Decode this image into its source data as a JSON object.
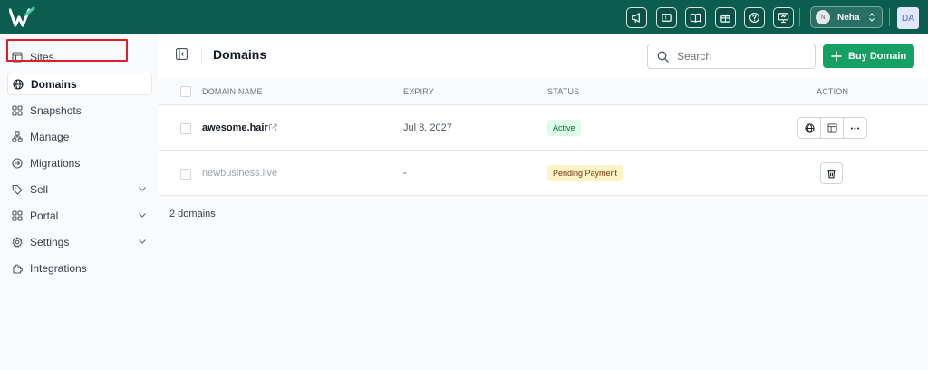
{
  "colors": {
    "topbar": "#0b5d4f",
    "brand_green": "#16a065",
    "highlight_border": "#e11d2a",
    "badge_active_bg": "#dcfce7",
    "badge_pending_bg": "#fef3c7"
  },
  "topbar": {
    "logo": "w-logo-icon",
    "icons": [
      "megaphone-icon",
      "ticket-icon",
      "book-icon",
      "gift-icon",
      "help-icon",
      "presentation-icon"
    ],
    "user": {
      "initial": "N",
      "name": "Neha"
    },
    "account_initials": "DA"
  },
  "sidebar": {
    "items": [
      {
        "label": "Sites",
        "icon": "layout-icon"
      },
      {
        "label": "Domains",
        "icon": "globe-icon",
        "active": true
      },
      {
        "label": "Snapshots",
        "icon": "grid-icon"
      },
      {
        "label": "Manage",
        "icon": "nodes-icon"
      },
      {
        "label": "Migrations",
        "icon": "arrow-circle-icon"
      },
      {
        "label": "Sell",
        "icon": "tag-icon",
        "expandable": true
      },
      {
        "label": "Portal",
        "icon": "grid-icon",
        "expandable": true
      },
      {
        "label": "Settings",
        "icon": "gear-icon",
        "expandable": true
      },
      {
        "label": "Integrations",
        "icon": "puzzle-icon"
      }
    ]
  },
  "header": {
    "title": "Domains",
    "search_placeholder": "Search",
    "buy_label": "Buy Domain"
  },
  "table": {
    "columns": [
      "DOMAIN NAME",
      "EXPIRY",
      "STATUS",
      "ACTION"
    ],
    "rows": [
      {
        "domain": "awesome.hair",
        "expiry": "Jul 8, 2027",
        "status": "Active",
        "actions": [
          "globe-icon",
          "layout-icon",
          "more-icon"
        ]
      },
      {
        "domain": "newbusiness.live",
        "expiry": "-",
        "status": "Pending Payment",
        "actions": [
          "trash-icon"
        ]
      }
    ],
    "count_text": "2 domains"
  }
}
